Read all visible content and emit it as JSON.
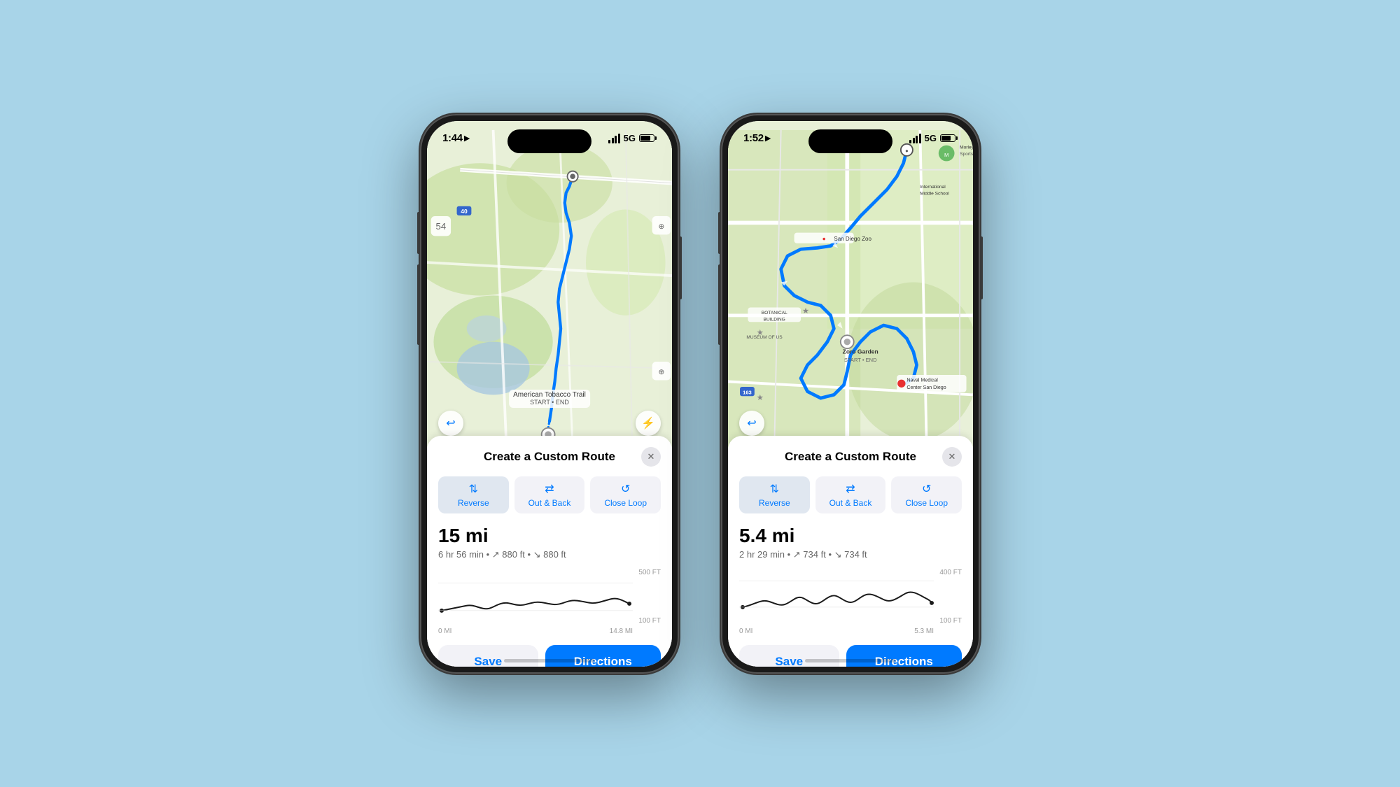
{
  "background_color": "#a8d4e8",
  "phones": [
    {
      "id": "phone1",
      "status_bar": {
        "time": "1:44",
        "has_location": true,
        "network": "5G",
        "battery_level": 85
      },
      "map": {
        "location": "American Tobacco Trail",
        "label": "American Tobacco Trail START • END"
      },
      "panel": {
        "title": "Create a Custom Route",
        "options": [
          {
            "id": "reverse",
            "label": "Reverse",
            "icon": "⇅",
            "active": true
          },
          {
            "id": "out-back",
            "label": "Out & Back",
            "icon": "⇄",
            "active": false
          },
          {
            "id": "close-loop",
            "label": "Close Loop",
            "icon": "↺",
            "active": false
          }
        ],
        "distance": "15 mi",
        "details": "6 hr 56 min • ↗ 880 ft • ↘ 880 ft",
        "chart": {
          "y_labels": [
            "500 FT",
            "100 FT"
          ],
          "x_labels": [
            "0 MI",
            "14.8 MI"
          ]
        },
        "save_label": "Save",
        "directions_label": "Directions"
      }
    },
    {
      "id": "phone2",
      "status_bar": {
        "time": "1:52",
        "has_location": true,
        "network": "5G",
        "battery_level": 75
      },
      "map": {
        "location": "Zoro Garden",
        "label": "Zoro Garden START • END"
      },
      "panel": {
        "title": "Create a Custom Route",
        "options": [
          {
            "id": "reverse",
            "label": "Reverse",
            "icon": "⇅",
            "active": true
          },
          {
            "id": "out-back",
            "label": "Out & Back",
            "icon": "⇄",
            "active": false
          },
          {
            "id": "close-loop",
            "label": "Close Loop",
            "icon": "↺",
            "active": false
          }
        ],
        "distance": "5.4 mi",
        "details": "2 hr 29 min • ↗ 734 ft • ↘ 734 ft",
        "chart": {
          "y_labels": [
            "400 FT",
            "100 FT"
          ],
          "x_labels": [
            "0 MI",
            "5.3 MI"
          ]
        },
        "save_label": "Save",
        "directions_label": "Directions"
      }
    }
  ]
}
